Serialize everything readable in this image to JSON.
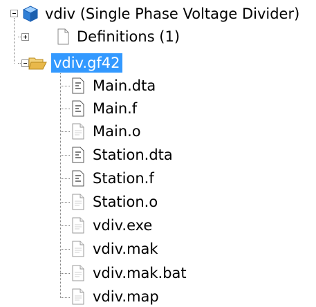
{
  "tree": {
    "root": {
      "label": "vdiv (Single Phase Voltage Divider)",
      "icon": "project-cube-icon",
      "expanded": true
    },
    "definitions": {
      "label": "Definitions (1)",
      "icon": "document-icon",
      "expanded": false
    },
    "folder": {
      "label": "vdiv.gf42",
      "icon": "open-folder-icon",
      "expanded": true,
      "selected": true
    },
    "files": [
      {
        "label": "Main.dta",
        "icon": "text-file-icon"
      },
      {
        "label": "Main.f",
        "icon": "text-file-icon"
      },
      {
        "label": "Main.o",
        "icon": "blank-file-icon"
      },
      {
        "label": "Station.dta",
        "icon": "text-file-icon"
      },
      {
        "label": "Station.f",
        "icon": "text-file-icon"
      },
      {
        "label": "Station.o",
        "icon": "blank-file-icon"
      },
      {
        "label": "vdiv.exe",
        "icon": "blank-file-icon"
      },
      {
        "label": "vdiv.mak",
        "icon": "blank-file-icon"
      },
      {
        "label": "vdiv.mak.bat",
        "icon": "blank-file-icon"
      },
      {
        "label": "vdiv.map",
        "icon": "blank-file-icon"
      }
    ],
    "colors": {
      "selection": "#3399ff",
      "tree_lines": "#808080",
      "project_icon": "#2f7fd6",
      "folder": "#e8b84a"
    }
  }
}
